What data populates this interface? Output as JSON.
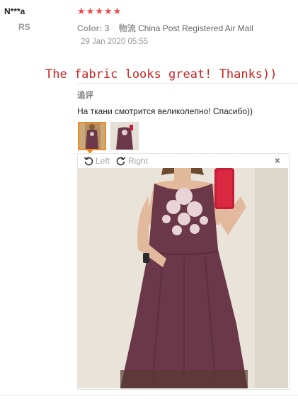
{
  "review": {
    "user_name": "N***a",
    "country": "RS",
    "rating": 5,
    "color_label": "Color:",
    "color_value": "3",
    "shipping_label": "物流",
    "shipping_value": "China Post Registered Air Mail",
    "date": "29 Jan 2020 05:55",
    "translation": "The fabric looks great! Thanks))",
    "section_label": "追评",
    "text": "На ткани смотрится великолепно! Спасибо))"
  },
  "viewer": {
    "rotate_left_label": "Left",
    "rotate_right_label": "Right",
    "close_symbol": "×"
  },
  "colors": {
    "star": "#f04848",
    "translation": "#cc1f1f",
    "thumb_active_border": "#f08a1c",
    "dress": "#6a3848",
    "wall": "#e9e3da"
  },
  "icons": [
    "star-icon",
    "rotate-left-icon",
    "rotate-right-icon",
    "close-icon"
  ]
}
